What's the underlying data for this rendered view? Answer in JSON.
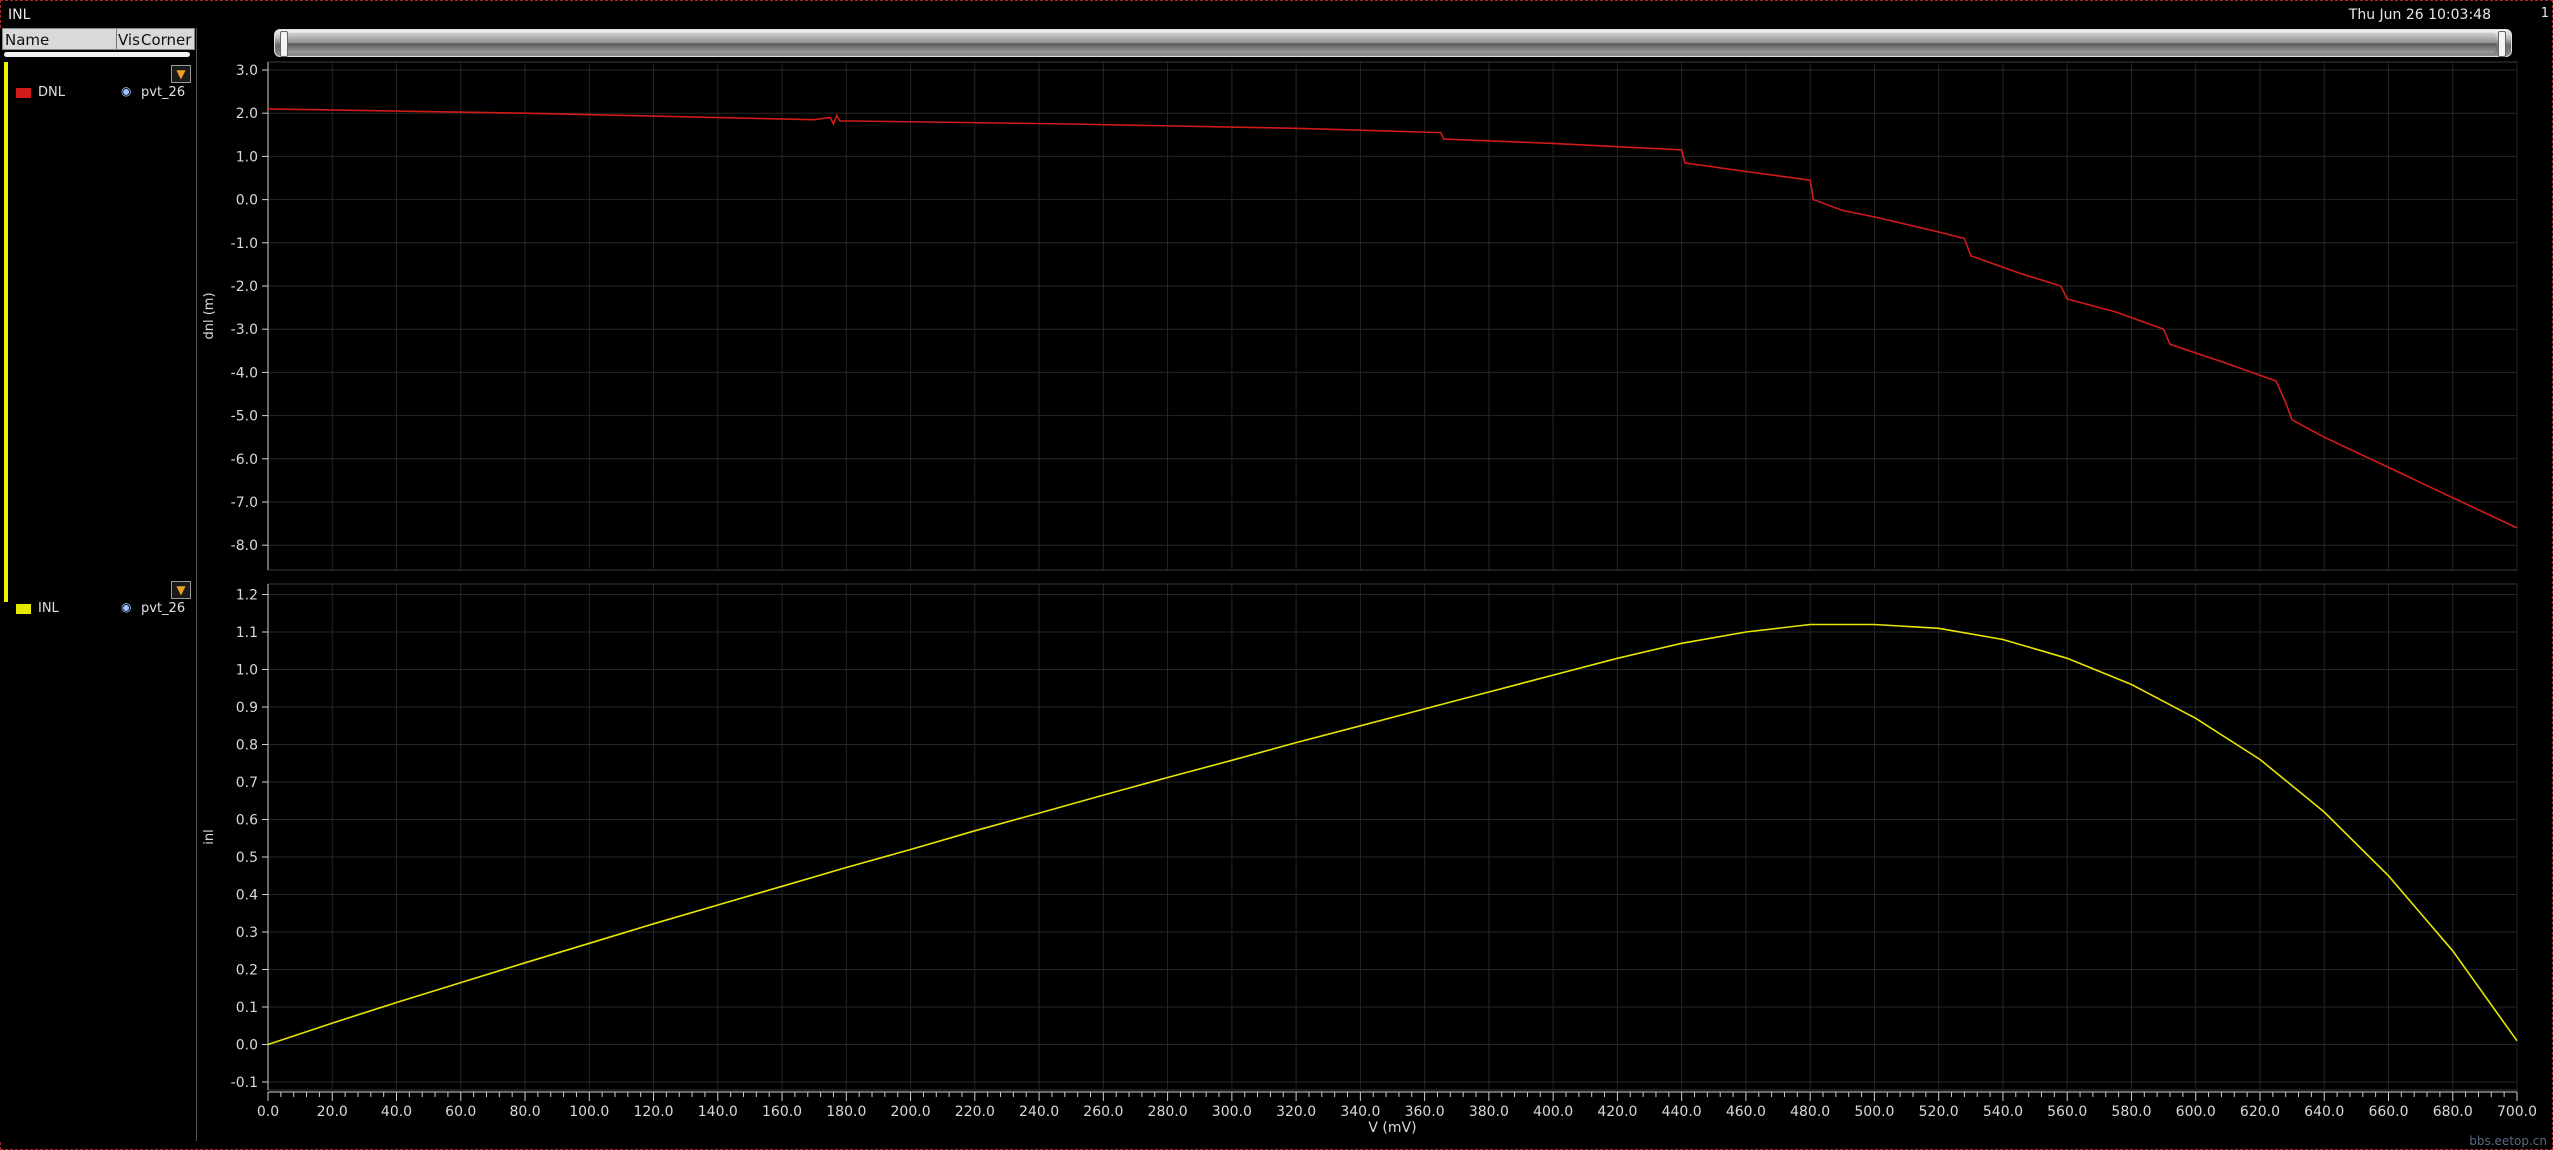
{
  "window": {
    "title": "INL",
    "timestamp": "Thu Jun 26 10:03:48",
    "corner_mark": "1",
    "watermark": "bbs.eetop.cn"
  },
  "legend": {
    "headers": {
      "name": "Name",
      "vis": "Vis",
      "corner": "Corner"
    },
    "items": [
      {
        "name": "DNL",
        "corner": "pvt_26",
        "color": "#d11a1a",
        "visible_icon": "eye-icon"
      },
      {
        "name": "INL",
        "corner": "pvt_26",
        "color": "#e6e600",
        "visible_icon": "eye-icon"
      }
    ],
    "filter_icon": "filter-icon"
  },
  "chart_data": [
    {
      "type": "line",
      "ylabel": "dnl (m)",
      "xlabel": "",
      "xlim": [
        0,
        700
      ],
      "ylim": [
        -8.5,
        3.0
      ],
      "yticks": [
        "3.0",
        "2.0",
        "1.0",
        "0.0",
        "-1.0",
        "-2.0",
        "-3.0",
        "-4.0",
        "-5.0",
        "-6.0",
        "-7.0",
        "-8.0"
      ],
      "grid": true,
      "series": [
        {
          "name": "DNL",
          "color": "#d11a1a",
          "x": [
            0,
            80,
            170,
            175,
            176,
            177,
            178,
            182,
            250,
            320,
            365,
            366,
            400,
            440,
            441,
            460,
            480,
            481,
            490,
            500,
            520,
            528,
            530,
            545,
            558,
            560,
            575,
            590,
            592,
            610,
            625,
            628,
            630,
            640,
            660,
            680,
            700
          ],
          "y": [
            2.1,
            2.0,
            1.85,
            1.9,
            1.75,
            1.95,
            1.82,
            1.82,
            1.75,
            1.65,
            1.55,
            1.4,
            1.3,
            1.15,
            0.85,
            0.65,
            0.45,
            0.0,
            -0.25,
            -0.4,
            -0.75,
            -0.9,
            -1.3,
            -1.7,
            -2.0,
            -2.3,
            -2.6,
            -3.0,
            -3.35,
            -3.8,
            -4.2,
            -4.7,
            -5.1,
            -5.5,
            -6.2,
            -6.9,
            -7.6
          ]
        }
      ]
    },
    {
      "type": "line",
      "ylabel": "inl",
      "xlabel": "V (mV)",
      "xlim": [
        0,
        700
      ],
      "ylim": [
        -0.12,
        1.25
      ],
      "yticks": [
        "1.2",
        "1.1",
        "1.0",
        "0.9",
        "0.8",
        "0.7",
        "0.6",
        "0.5",
        "0.4",
        "0.3",
        "0.2",
        "0.1",
        "0.0",
        "-0.1"
      ],
      "xticks": [
        "0.0",
        "20.0",
        "40.0",
        "60.0",
        "80.0",
        "100.0",
        "120.0",
        "140.0",
        "160.0",
        "180.0",
        "200.0",
        "220.0",
        "240.0",
        "260.0",
        "280.0",
        "300.0",
        "320.0",
        "340.0",
        "360.0",
        "380.0",
        "400.0",
        "420.0",
        "440.0",
        "460.0",
        "480.0",
        "500.0",
        "520.0",
        "540.0",
        "560.0",
        "580.0",
        "600.0",
        "620.0",
        "640.0",
        "660.0",
        "680.0",
        "700.0"
      ],
      "grid": true,
      "series": [
        {
          "name": "INL",
          "color": "#e6e600",
          "x": [
            0,
            20,
            40,
            60,
            80,
            100,
            120,
            140,
            160,
            180,
            200,
            220,
            240,
            260,
            280,
            300,
            320,
            340,
            360,
            380,
            400,
            420,
            440,
            460,
            480,
            500,
            520,
            540,
            560,
            580,
            600,
            620,
            640,
            660,
            680,
            700
          ],
          "y": [
            0.0,
            0.057,
            0.112,
            0.165,
            0.218,
            0.27,
            0.322,
            0.372,
            0.422,
            0.472,
            0.52,
            0.57,
            0.617,
            0.665,
            0.712,
            0.758,
            0.805,
            0.85,
            0.895,
            0.94,
            0.985,
            1.03,
            1.07,
            1.1,
            1.12,
            1.12,
            1.11,
            1.08,
            1.03,
            0.96,
            0.87,
            0.76,
            0.62,
            0.45,
            0.25,
            0.01
          ]
        }
      ]
    }
  ]
}
